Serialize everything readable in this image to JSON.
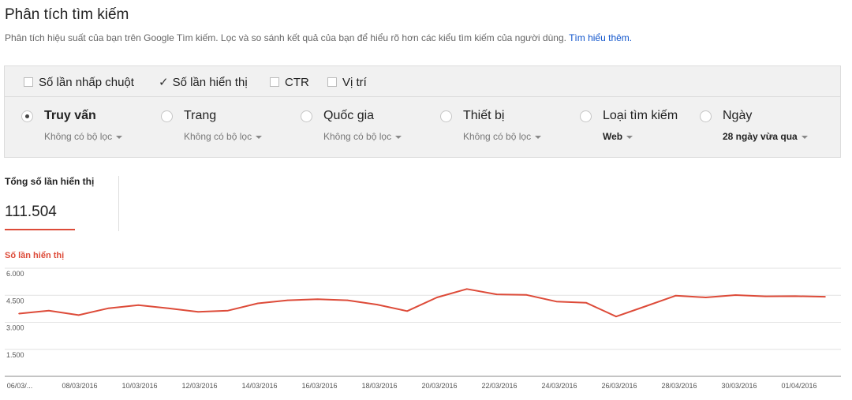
{
  "header": {
    "title": "Phân tích tìm kiếm",
    "description": "Phân tích hiệu suất của bạn trên Google Tìm kiếm. Lọc và so sánh kết quả của bạn để hiểu rõ hơn các kiểu tìm kiếm của người dùng.",
    "learn_more": "Tìm hiểu thêm."
  },
  "metrics": [
    {
      "label": "Số lần nhấp chuột",
      "checked": false
    },
    {
      "label": "Số lần hiển thị",
      "checked": true
    },
    {
      "label": "CTR",
      "checked": false
    },
    {
      "label": "Vị trí",
      "checked": false
    }
  ],
  "groups": [
    {
      "label": "Truy vấn",
      "filter": "Không có bộ lọc",
      "selected": true
    },
    {
      "label": "Trang",
      "filter": "Không có bộ lọc",
      "selected": false
    },
    {
      "label": "Quốc gia",
      "filter": "Không có bộ lọc",
      "selected": false
    },
    {
      "label": "Thiết bị",
      "filter": "Không có bộ lọc",
      "selected": false
    },
    {
      "label": "Loại tìm kiếm",
      "filter": "Web",
      "selected": false
    },
    {
      "label": "Ngày",
      "filter": "28 ngày vừa qua",
      "selected": false
    }
  ],
  "totals": {
    "label": "Tổng số lần hiển thị",
    "value": "111.504"
  },
  "colors": {
    "accent": "#dd4b39",
    "link": "#1155cc"
  },
  "chart_data": {
    "type": "line",
    "title": "",
    "ylabel": "Số lần hiển thị",
    "ylim": [
      0,
      6000
    ],
    "yticks": [
      "6.000",
      "4.500",
      "3.000",
      "1.500"
    ],
    "xtick_labels": [
      "06/03/...",
      "08/03/2016",
      "10/03/2016",
      "12/03/2016",
      "14/03/2016",
      "16/03/2016",
      "18/03/2016",
      "20/03/2016",
      "22/03/2016",
      "24/03/2016",
      "26/03/2016",
      "28/03/2016",
      "30/03/2016",
      "01/04/2016"
    ],
    "series": [
      {
        "name": "Số lần hiển thị",
        "values": [
          3480,
          3650,
          3400,
          3780,
          3950,
          3780,
          3580,
          3650,
          4050,
          4220,
          4280,
          4220,
          3980,
          3620,
          4380,
          4850,
          4550,
          4520,
          4150,
          4080,
          3320,
          3900,
          4480,
          4380,
          4510,
          4440,
          4450,
          4420
        ]
      }
    ]
  }
}
